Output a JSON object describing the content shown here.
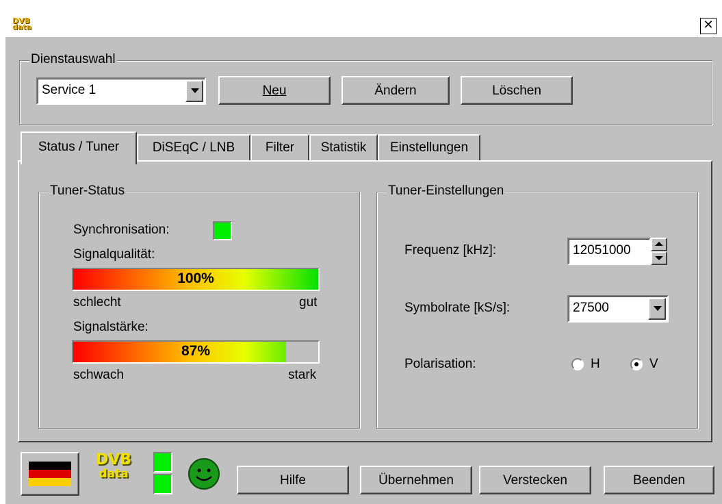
{
  "window": {
    "app_logo": "DVB data",
    "close_label": "x"
  },
  "service_group": {
    "title": "Dienstauswahl",
    "selected_service": "Service 1",
    "new_label": "Neu",
    "change_label": "Ändern",
    "delete_label": "Löschen"
  },
  "tabs": [
    {
      "label": "Status / Tuner"
    },
    {
      "label": "DiSEqC / LNB"
    },
    {
      "label": "Filter"
    },
    {
      "label": "Statistik"
    },
    {
      "label": "Einstellungen"
    }
  ],
  "tuner_status": {
    "title": "Tuner-Status",
    "sync_label": "Synchronisation:",
    "quality_label": "Signalqualität:",
    "quality_value": "100%",
    "quality_fraction": 1.0,
    "quality_low": "schlecht",
    "quality_high": "gut",
    "strength_label": "Signalstärke:",
    "strength_value": "87%",
    "strength_fraction": 0.87,
    "strength_low": "schwach",
    "strength_high": "stark"
  },
  "tuner_settings": {
    "title": "Tuner-Einstellungen",
    "frequency_label": "Frequenz [kHz]:",
    "frequency_value": "12051000",
    "symbolrate_label": "Symbolrate [kS/s]:",
    "symbolrate_value": "27500",
    "polarisation_label": "Polarisation:",
    "pol_h": "H",
    "pol_v": "V",
    "pol_selected": "V"
  },
  "footer": {
    "logo_top": "DVB",
    "logo_bottom": "data",
    "help_label": "Hilfe",
    "apply_label": "Übernehmen",
    "hide_label": "Verstecken",
    "exit_label": "Beenden"
  },
  "colors": {
    "led": "#00ee00",
    "flag_black": "#000000",
    "flag_red": "#dd0000",
    "flag_gold": "#ffce00",
    "smiley": "#1a9a1a"
  }
}
